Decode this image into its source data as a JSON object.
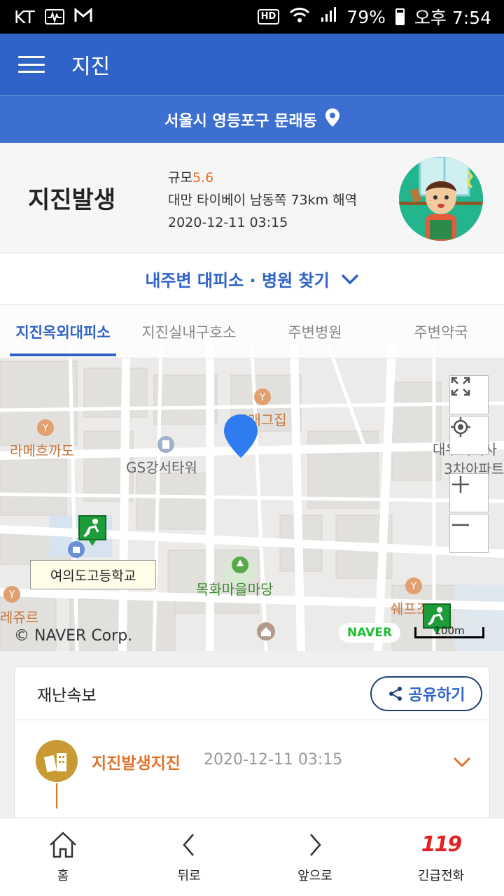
{
  "status_bar": {
    "carrier": "KT",
    "hd": "HD",
    "battery": "79%",
    "time": "오후 7:54"
  },
  "app_bar": {
    "title": "지진"
  },
  "location": {
    "text": "서울시 영등포구 문래동"
  },
  "quake": {
    "title": "지진발생",
    "magnitude_label": "규모",
    "magnitude_value": "5.6",
    "location": "대만 타이베이 남동쪽 73km 해역",
    "datetime": "2020-12-11 03:15"
  },
  "find_shelter": {
    "label": "내주변 대피소 · 병원 찾기"
  },
  "tabs": [
    {
      "label": "지진옥외대피소",
      "active": true
    },
    {
      "label": "지진실내구호소",
      "active": false
    },
    {
      "label": "주변병원",
      "active": false
    },
    {
      "label": "주변약국",
      "active": false
    }
  ],
  "map": {
    "pois": {
      "cafe": "모래그집",
      "ramen": "라메흐까도",
      "tower": "GS강서타워",
      "apt": "대우미래사",
      "apt2": "3차아파트",
      "school": "여의도고등학교",
      "park": "목화마을마당",
      "left_bottom": "레쥬르",
      "chef": "쉐프조"
    },
    "copyright": "© NAVER Corp.",
    "logo": "NAVER",
    "scale": "100m"
  },
  "alert": {
    "title": "재난속보",
    "share_label": "공유하기",
    "item_name": "지진발생지진",
    "item_time": "2020-12-11 03:15"
  },
  "bottom_nav": [
    {
      "label": "홈"
    },
    {
      "label": "뒤로"
    },
    {
      "label": "앞으로"
    },
    {
      "label": "긴급전화"
    }
  ],
  "emergency_number": "119",
  "colors": {
    "primary": "#2f63c7",
    "accent": "#e1722b",
    "green": "#23b58e"
  }
}
